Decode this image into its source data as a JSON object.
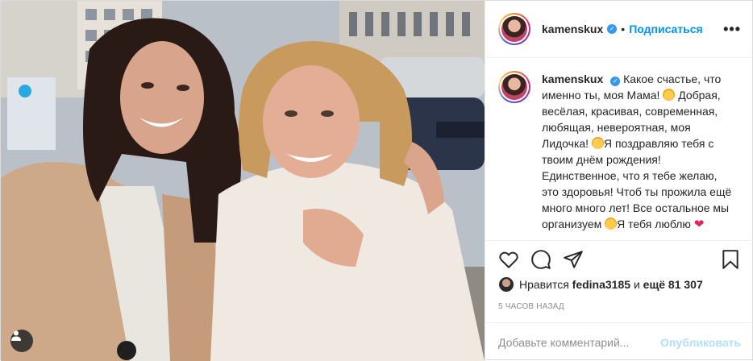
{
  "post": {
    "photo_alt": "",
    "header": {
      "username": "kamenskux",
      "separator": "•",
      "follow_label": "Подписаться",
      "more_label": "•••"
    },
    "caption": {
      "username": "kamenskux",
      "part1": "Какое счастье, что именно ты, моя Мама!",
      "part2": "Добрая, весёлая, красивая, современная, любящая, невероятная, моя Лидочка!",
      "part3": "Я поздравляю тебя с твоим днём рождения! Единственное, что я тебе желаю, это здоровья! Чтоб ты прожила ещё много много лет! Все остальное мы организуем",
      "part4": "Я тебя люблю",
      "heart": "❤"
    },
    "likes": {
      "prefix": "Нравится",
      "user": "fedina3185",
      "middle": "и",
      "count": "ещё 81 307"
    },
    "time_ago": "5 ЧАСОВ НАЗАД",
    "comment": {
      "placeholder": "Добавьте комментарий...",
      "publish_label": "Опубликовать"
    },
    "colors": {
      "accent": "#0095f6",
      "verified": "#3897f0",
      "publish_disabled": "#b2dffc",
      "heart": "#e0245e"
    }
  }
}
